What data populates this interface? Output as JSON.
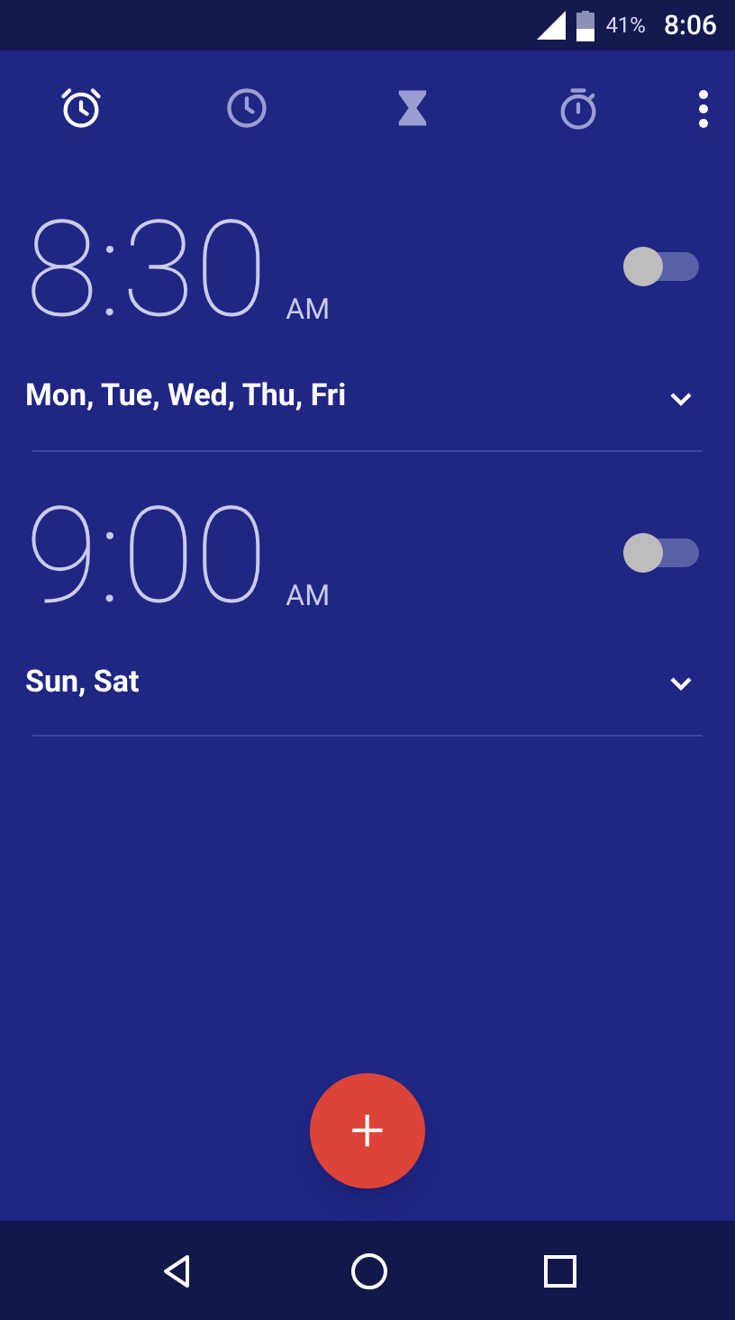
{
  "status_bar": {
    "battery": "41%",
    "time": "8:06"
  },
  "tabs": [
    {
      "kind": "alarm",
      "selected": true
    },
    {
      "kind": "clock",
      "selected": false
    },
    {
      "kind": "timer",
      "selected": false
    },
    {
      "kind": "stopwatch",
      "selected": false
    }
  ],
  "alarms": [
    {
      "time": "8:30",
      "period": "AM",
      "on": false,
      "days": "Mon, Tue, Wed, Thu, Fri",
      "expanded": false
    },
    {
      "time": "9:00",
      "period": "AM",
      "on": false,
      "days": "Sun, Sat",
      "expanded": false
    }
  ],
  "fab": {
    "label": "+"
  }
}
